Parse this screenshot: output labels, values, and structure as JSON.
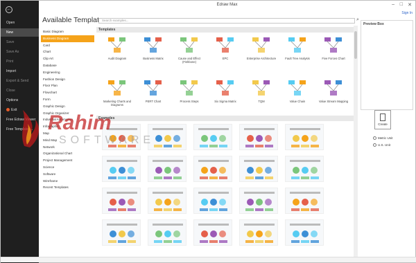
{
  "window": {
    "title": "Edraw Max",
    "sign_in": "Sign In",
    "minimize": "–",
    "maximize": "□",
    "close": "✕"
  },
  "sidebar": {
    "items": [
      {
        "label": "Open",
        "state": "normal"
      },
      {
        "label": "New",
        "state": "active"
      },
      {
        "label": "Save",
        "state": "dim"
      },
      {
        "label": "Save As",
        "state": "dim"
      },
      {
        "label": "Print",
        "state": "dim"
      },
      {
        "label": "Import",
        "state": "normal"
      },
      {
        "label": "Export & Send",
        "state": "dim"
      },
      {
        "label": "Close",
        "state": "dim"
      },
      {
        "label": "Options",
        "state": "normal"
      },
      {
        "label": "Exit",
        "state": "normal"
      },
      {
        "label": "Free Edraw Viewer",
        "state": "normal"
      },
      {
        "label": "Free Templates...",
        "state": "normal"
      }
    ]
  },
  "heading": "Available Templates",
  "search": {
    "placeholder": "Search examples..."
  },
  "categories": [
    "Basic Diagram",
    "Business Diagram",
    "Card",
    "Chart",
    "Clip Art",
    "Database",
    "Engineering",
    "Fashion Design",
    "Floor Plan",
    "Flowchart",
    "Form",
    "Graphic Design",
    "Graphic Organizer",
    "Industrial Automation",
    "Infographic",
    "Map",
    "Mind Map",
    "Network",
    "Organizational Chart",
    "Project Management",
    "Science",
    "Software",
    "Wireframe",
    "Recent Templates"
  ],
  "active_category": "Business Diagram",
  "sections": {
    "templates": "Templates",
    "examples": "Examples"
  },
  "templates": [
    {
      "label": "Audit Diagram",
      "icon": "audit-diagram-icon"
    },
    {
      "label": "Business Matrix",
      "icon": "business-matrix-icon"
    },
    {
      "label": "Cause and Effect (Fishbone)",
      "icon": "cause-effect-icon"
    },
    {
      "label": "EPC",
      "icon": "epc-icon"
    },
    {
      "label": "Enterprise Architecture",
      "icon": "enterprise-architecture-icon"
    },
    {
      "label": "Fault Tree Analysis",
      "icon": "fault-tree-icon"
    },
    {
      "label": "Five Forces Chart",
      "icon": "five-forces-icon"
    },
    {
      "label": "Marketing Charts and Diagrams",
      "icon": "marketing-charts-icon"
    },
    {
      "label": "PERT Chart",
      "icon": "pert-chart-icon"
    },
    {
      "label": "Process Steps",
      "icon": "process-steps-icon"
    },
    {
      "label": "Six Sigma Matrix",
      "icon": "six-sigma-icon"
    },
    {
      "label": "TQM",
      "icon": "tqm-icon"
    },
    {
      "label": "Value Chain",
      "icon": "value-chain-icon"
    },
    {
      "label": "Value Stream Mapping",
      "icon": "value-stream-icon"
    }
  ],
  "preview": {
    "title": "Preview Box"
  },
  "create": {
    "label": "Create"
  },
  "units": {
    "metric": "Metric Unit",
    "us": "U.S. Unit"
  },
  "watermark": {
    "line1": "Rahim",
    "line2": "SOFTWARE"
  },
  "colors": {
    "accent": "#f5a31a",
    "sidebar": "#1f1f1f",
    "exit": "#e55c2a",
    "watermark_red": "#c0191b"
  }
}
